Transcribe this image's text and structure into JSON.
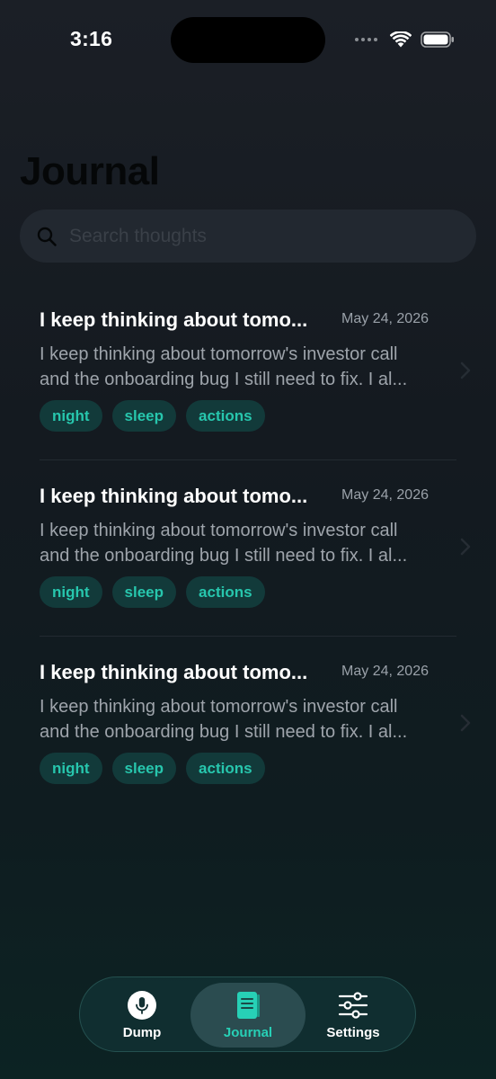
{
  "status_bar": {
    "time": "3:16"
  },
  "header": {
    "title": "Journal"
  },
  "search": {
    "placeholder": "Search thoughts",
    "value": ""
  },
  "entries": [
    {
      "title": "I keep thinking about tomo...",
      "date": "May 24, 2026",
      "preview": "I keep thinking about tomorrow's investor call and the onboarding bug I still need to fix. I al...",
      "tags": [
        "night",
        "sleep",
        "actions"
      ]
    },
    {
      "title": "I keep thinking about tomo...",
      "date": "May 24, 2026",
      "preview": "I keep thinking about tomorrow's investor call and the onboarding bug I still need to fix. I al...",
      "tags": [
        "night",
        "sleep",
        "actions"
      ]
    },
    {
      "title": "I keep thinking about tomo...",
      "date": "May 24, 2026",
      "preview": "I keep thinking about tomorrow's investor call and the onboarding bug I still need to fix. I al...",
      "tags": [
        "night",
        "sleep",
        "actions"
      ]
    }
  ],
  "tab_bar": {
    "tabs": [
      {
        "label": "Dump",
        "icon": "microphone-icon",
        "active": false
      },
      {
        "label": "Journal",
        "icon": "book-icon",
        "active": true
      },
      {
        "label": "Settings",
        "icon": "sliders-icon",
        "active": false
      }
    ]
  },
  "colors": {
    "accent": "#27d0b6",
    "tag_background": "#123a3a",
    "background": "#141a20"
  }
}
